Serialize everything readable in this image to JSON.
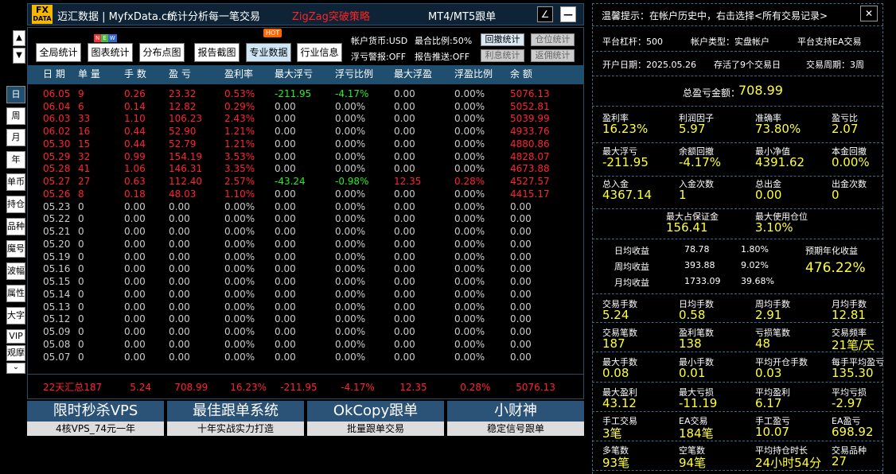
{
  "app": {
    "logo_top": "FX",
    "logo_bottom": "DATA",
    "title": "迈汇数据 | MyfxData.cn",
    "subtitle": "统计分析每一笔交易",
    "strategy": "ZigZag突破策略",
    "mode": "MT4/MT5跟单",
    "icon_diag": "∠",
    "icon_min": "—",
    "icon_close": "✕"
  },
  "toolbar": {
    "global": "全局统计",
    "chart": "图表统计",
    "dist": "分布点图",
    "report": "报告截图",
    "pro": "专业数据",
    "industry": "行业信息",
    "new_badge": "NEW",
    "hot_badge": "HOT"
  },
  "account": {
    "currency": "帐户货币:USD",
    "ratio": "最合比例:50%",
    "float_alert": "浮亏警报:OFF",
    "report_push": "报告推送:OFF",
    "btn_drawdown": "回撤统计",
    "btn_position": "仓位统计",
    "btn_interest": "利息统计",
    "btn_rebate": "返佣统计"
  },
  "side": {
    "up": "▲",
    "down": "▼",
    "items": [
      "日",
      "周",
      "月",
      "年",
      "单币",
      "持仓",
      "品种",
      "魔号",
      "波幅",
      "属性",
      "大字",
      "VIP",
      "观摩"
    ],
    "more": "⌄"
  },
  "table": {
    "headers": [
      "日 期",
      "单 量",
      "手 数",
      "盈 亏",
      "盈利率",
      "最大浮亏",
      "浮亏比例",
      "最大浮盈",
      "浮盈比例",
      "余 额"
    ],
    "rows": [
      [
        "06.05",
        "9",
        "0.26",
        "23.32",
        "0.53%",
        "-211.95",
        "-4.17%",
        "0.00",
        "0.00%",
        "5076.13"
      ],
      [
        "06.04",
        "6",
        "0.14",
        "12.82",
        "0.29%",
        "0.00",
        "0.00%",
        "0.00",
        "0.00%",
        "5052.81"
      ],
      [
        "06.03",
        "33",
        "1.10",
        "106.23",
        "2.43%",
        "0.00",
        "0.00%",
        "0.00",
        "0.00%",
        "5039.99"
      ],
      [
        "06.02",
        "16",
        "0.44",
        "52.90",
        "1.21%",
        "0.00",
        "0.00%",
        "0.00",
        "0.00%",
        "4933.76"
      ],
      [
        "05.30",
        "15",
        "0.44",
        "52.79",
        "1.21%",
        "0.00",
        "0.00%",
        "0.00",
        "0.00%",
        "4880.86"
      ],
      [
        "05.29",
        "32",
        "0.99",
        "154.19",
        "3.53%",
        "0.00",
        "0.00%",
        "0.00",
        "0.00%",
        "4828.07"
      ],
      [
        "05.28",
        "41",
        "1.06",
        "146.31",
        "3.35%",
        "0.00",
        "0.00%",
        "0.00",
        "0.00%",
        "4673.88"
      ],
      [
        "05.27",
        "27",
        "0.63",
        "112.40",
        "2.57%",
        "-43.24",
        "-0.98%",
        "12.35",
        "0.28%",
        "4527.57"
      ],
      [
        "05.26",
        "8",
        "0.18",
        "48.03",
        "1.10%",
        "0.00",
        "0.00%",
        "0.00",
        "0.00%",
        "4415.17"
      ],
      [
        "05.23",
        "0",
        "0.00",
        "0.00",
        "0.00%",
        "0.00",
        "0.00%",
        "0.00",
        "0.00%",
        "0.00"
      ],
      [
        "05.22",
        "0",
        "0.00",
        "0.00",
        "0.00%",
        "0.00",
        "0.00%",
        "0.00",
        "0.00%",
        "0.00"
      ],
      [
        "05.21",
        "0",
        "0.00",
        "0.00",
        "0.00%",
        "0.00",
        "0.00%",
        "0.00",
        "0.00%",
        "0.00"
      ],
      [
        "05.20",
        "0",
        "0.00",
        "0.00",
        "0.00%",
        "0.00",
        "0.00%",
        "0.00",
        "0.00%",
        "0.00"
      ],
      [
        "05.19",
        "0",
        "0.00",
        "0.00",
        "0.00%",
        "0.00",
        "0.00%",
        "0.00",
        "0.00%",
        "0.00"
      ],
      [
        "05.16",
        "0",
        "0.00",
        "0.00",
        "0.00%",
        "0.00",
        "0.00%",
        "0.00",
        "0.00%",
        "0.00"
      ],
      [
        "05.15",
        "0",
        "0.00",
        "0.00",
        "0.00%",
        "0.00",
        "0.00%",
        "0.00",
        "0.00%",
        "0.00"
      ],
      [
        "05.14",
        "0",
        "0.00",
        "0.00",
        "0.00%",
        "0.00",
        "0.00%",
        "0.00",
        "0.00%",
        "0.00"
      ],
      [
        "05.13",
        "0",
        "0.00",
        "0.00",
        "0.00%",
        "0.00",
        "0.00%",
        "0.00",
        "0.00%",
        "0.00"
      ],
      [
        "05.12",
        "0",
        "0.00",
        "0.00",
        "0.00%",
        "0.00",
        "0.00%",
        "0.00",
        "0.00%",
        "0.00"
      ],
      [
        "05.09",
        "0",
        "0.00",
        "0.00",
        "0.00%",
        "0.00",
        "0.00%",
        "0.00",
        "0.00%",
        "0.00"
      ],
      [
        "05.08",
        "0",
        "0.00",
        "0.00",
        "0.00%",
        "0.00",
        "0.00%",
        "0.00",
        "0.00%",
        "0.00"
      ],
      [
        "05.07",
        "0",
        "0.00",
        "0.00",
        "0.00%",
        "0.00",
        "0.00%",
        "0.00",
        "0.00%",
        "0.00"
      ]
    ],
    "summary": [
      "22天汇总",
      "187",
      "5.24",
      "708.99",
      "16.23%",
      "-211.95",
      "-4.17%",
      "12.35",
      "0.28%",
      "5076.13"
    ]
  },
  "banners": [
    {
      "title": "限时秒杀VPS",
      "sub": "4核VPS_74元一年"
    },
    {
      "title": "最佳跟单系统",
      "sub": "十年实战实力打造"
    },
    {
      "title": "OkCopy跟单",
      "sub": "批量跟单交易"
    },
    {
      "title": "小财神",
      "sub": "稳定信号跟单"
    }
  ],
  "panel": {
    "tip": "温馨提示：在帐户历史中，右击选择<所有交易记录>",
    "close": "✕",
    "leverage": "平台杠杆：500",
    "acct_type": "帐户类型：实盘帐户",
    "ea_support": "平台支持EA交易",
    "open_date": "开户日期：2025.05.26",
    "days": "存活了9个交易日",
    "period": "交易周期：3周",
    "total_label": "总盈亏金额：",
    "total_value": "708.99",
    "g1": [
      [
        "盈利率",
        "16.23%"
      ],
      [
        "利润因子",
        "5.97"
      ],
      [
        "准确率",
        "73.80%"
      ],
      [
        "盈亏比",
        "2.07"
      ]
    ],
    "g2": [
      [
        "最大浮亏",
        "-211.95"
      ],
      [
        "余额回撤",
        "-4.17%"
      ],
      [
        "最小净值",
        "4391.62"
      ],
      [
        "本金回撤",
        "0.00%"
      ]
    ],
    "g3": [
      [
        "总入金",
        "4367.14"
      ],
      [
        "入金次数",
        "1"
      ],
      [
        "总出金",
        "0.00"
      ],
      [
        "出金次数",
        "0"
      ]
    ],
    "g4": [
      [
        "最大占保证金",
        "156.41"
      ],
      [
        "最大使用仓位",
        "3.10%"
      ]
    ],
    "avg": [
      [
        "日均收益",
        "78.78",
        "1.80%"
      ],
      [
        "周均收益",
        "393.88",
        "9.02%"
      ],
      [
        "月均收益",
        "1733.09",
        "39.68%"
      ]
    ],
    "annual_label": "预期年化收益",
    "annual_value": "476.22%",
    "g5": [
      [
        "交易手数",
        "5.24"
      ],
      [
        "日均手数",
        "0.58"
      ],
      [
        "周均手数",
        "2.91"
      ],
      [
        "月均手数",
        "12.81"
      ]
    ],
    "g6": [
      [
        "交易笔数",
        "187"
      ],
      [
        "盈利笔数",
        "138"
      ],
      [
        "亏损笔数",
        "48"
      ],
      [
        "交易频率",
        "21笔/天"
      ]
    ],
    "g7": [
      [
        "最大手数",
        "0.08"
      ],
      [
        "最小手数",
        "0.01"
      ],
      [
        "平均开仓手数",
        "0.03"
      ],
      [
        "每手平均盈亏",
        "135.30"
      ]
    ],
    "g8": [
      [
        "最大盈利",
        "43.12"
      ],
      [
        "最大亏损",
        "-11.19"
      ],
      [
        "平均盈利",
        "6.17"
      ],
      [
        "平均亏损",
        "-2.97"
      ]
    ],
    "g9": [
      [
        "手工交易",
        "3笔"
      ],
      [
        "EA交易",
        "184笔"
      ],
      [
        "手工盈亏",
        "10.07"
      ],
      [
        "EA盈亏",
        "698.92"
      ]
    ],
    "g10": [
      [
        "多笔数",
        "93笔"
      ],
      [
        "空笔数",
        "94笔"
      ],
      [
        "平均持仓时长",
        "24小时54分"
      ],
      [
        "交易品种",
        "27"
      ]
    ]
  }
}
